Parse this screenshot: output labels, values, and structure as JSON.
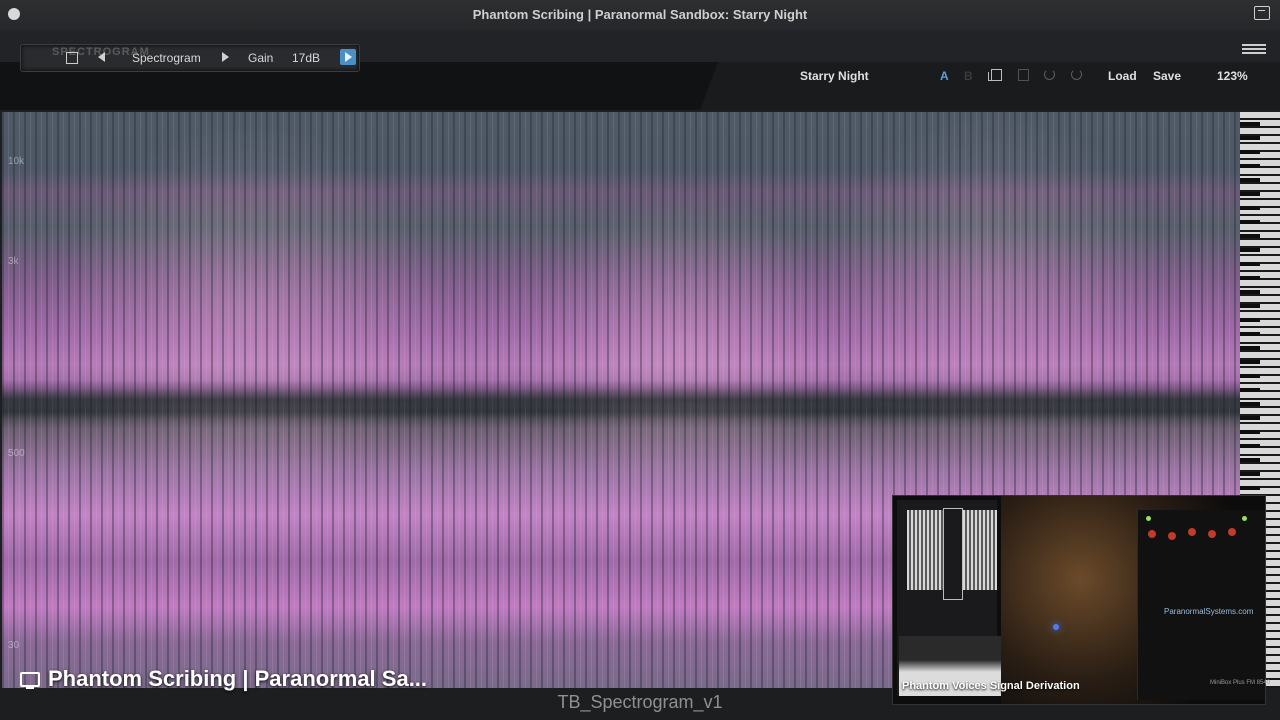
{
  "window": {
    "title": "Phantom Scribing | Paranormal Sandbox: Starry Night"
  },
  "plugin": {
    "logo": "SPECTROGRAM",
    "mode_label": "Spectrogram",
    "gain_label": "Gain",
    "gain_value": "17dB"
  },
  "preset_bar": {
    "preset_name": "Starry Night",
    "a_label": "A",
    "b_label": "B",
    "load_label": "Load",
    "save_label": "Save",
    "zoom": "123%"
  },
  "spectrogram": {
    "freq_labels": [
      "10k",
      "3k",
      "500",
      "30"
    ],
    "palette": {
      "high": "#c284c6",
      "low": "#505a66",
      "accent": "#4a90c8"
    }
  },
  "caption": {
    "text": "Phantom Scribing | Paranormal Sa..."
  },
  "footer": {
    "title": "TB_Spectrogram_v1"
  },
  "pip": {
    "label": "Phantom Voices Signal Derivation",
    "brand": "ParanormalSystems.com",
    "model": "MiniBox Plus FM 8540"
  }
}
